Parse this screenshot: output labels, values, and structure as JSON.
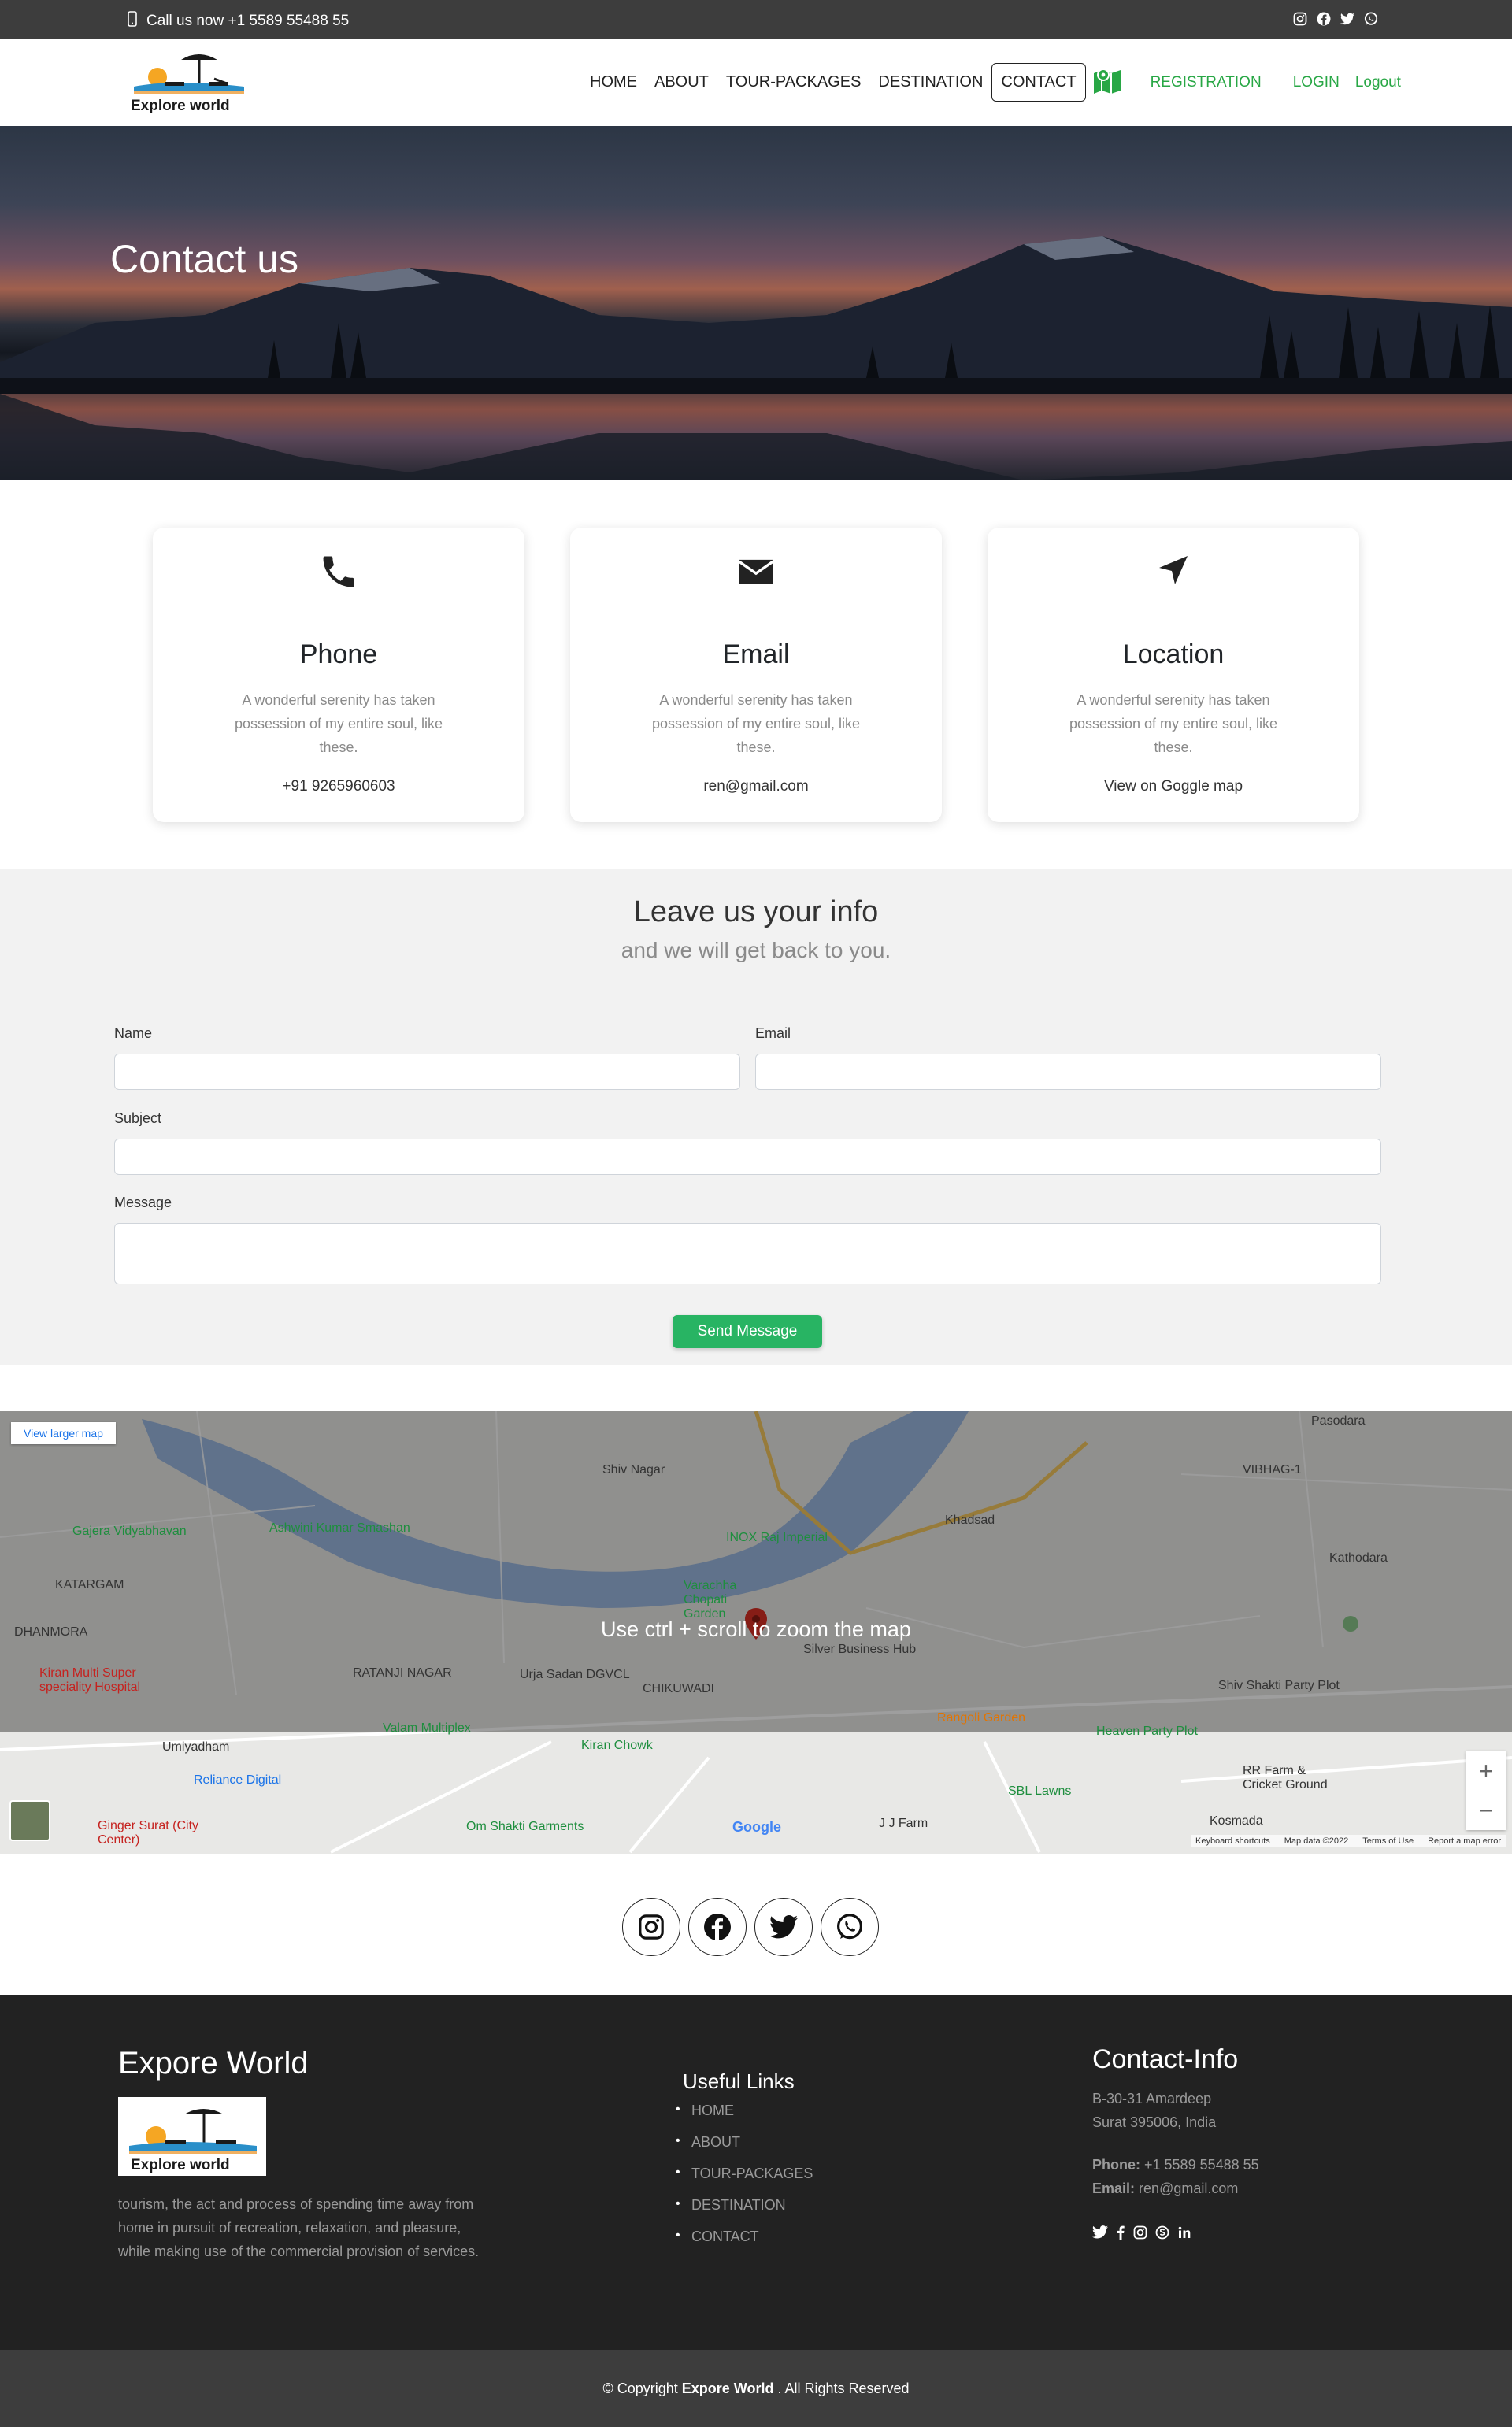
{
  "topbar": {
    "phone_text": "Call us now +1 5589 55488 55"
  },
  "brand": {
    "logo_text": "Explore world"
  },
  "nav": {
    "items": [
      "HOME",
      "ABOUT",
      "TOUR-PACKAGES",
      "DESTINATION",
      "CONTACT"
    ],
    "active": "CONTACT",
    "registration": "REGISTRATION",
    "login": "LOGIN",
    "logout": "Logout"
  },
  "hero": {
    "title": "Contact us"
  },
  "cards": [
    {
      "title": "Phone",
      "text": "A wonderful serenity has taken possession of my entire soul, like these.",
      "value": "+91 9265960603"
    },
    {
      "title": "Email",
      "text": "A wonderful serenity has taken possession of my entire soul, like these.",
      "value": "ren@gmail.com"
    },
    {
      "title": "Location",
      "text": "A wonderful serenity has taken possession of my entire soul, like these.",
      "value": "View on Goggle map"
    }
  ],
  "form": {
    "heading": "Leave us your info",
    "subheading": "and we will get back to you.",
    "name_label": "Name",
    "email_label": "Email",
    "subject_label": "Subject",
    "message_label": "Message",
    "submit": "Send Message"
  },
  "map": {
    "larger_link": "View larger map",
    "hint": "Use ctrl + scroll to zoom the map",
    "places": [
      "Shiv Nagar",
      "Khadsad",
      "Pasodara",
      "Kathodara",
      "KATARGAM",
      "DHANMORA",
      "Kiran Multi Super speciality Hospital",
      "RATANJI NAGAR",
      "CHIKUWADI",
      "Varachha Chopati Garden",
      "Silver Business Hub",
      "Shiv Shakti Party Plot",
      "Heaven Party Plot",
      "RR Farm & Cricket Ground",
      "Kosmada",
      "SBL Lawns",
      "J J Farm",
      "Rangoli Garden",
      "Om Shakti Garments",
      "Reliance Digital",
      "Ginger Surat (City Center)",
      "Umiyadham",
      "Kiran Chowk",
      "VIBHAG-1",
      "INOX Raj Imperial",
      "Ashwini Kumar Smashan",
      "Gajera Vidyabhavan",
      "Urja Sadan DGVCL",
      "Valam Multiplex"
    ],
    "google": "Google",
    "attribution": [
      "Keyboard shortcuts",
      "Map data ©2022",
      "Terms of Use",
      "Report a map error"
    ],
    "zoom_in": "+",
    "zoom_out": "−"
  },
  "footer": {
    "brand": "Expore World",
    "about": "tourism, the act and process of spending time away from home in pursuit of recreation, relaxation, and pleasure, while making use of the commercial provision of services.",
    "links_title": "Useful Links",
    "links": [
      "HOME",
      "ABOUT",
      "TOUR-PACKAGES",
      "DESTINATION",
      "CONTACT"
    ],
    "contact_title": "Contact-Info",
    "address_1": "B-30-31 Amardeep",
    "address_2": "Surat 395006, India",
    "phone_label": "Phone:",
    "phone": "+1 5589 55488 55",
    "email_label": "Email:",
    "email": "ren@gmail.com"
  },
  "copyright": {
    "prefix": "© Copyright",
    "brand": "Expore World",
    "suffix": ". All Rights Reserved"
  }
}
